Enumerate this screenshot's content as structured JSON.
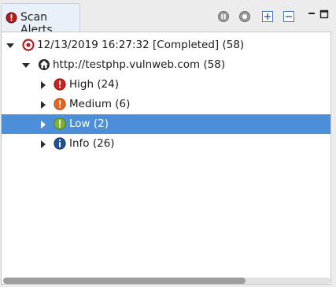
{
  "view": {
    "tab_title": "Scan Alerts",
    "tab_icon": "alert-icon",
    "toolbar": [
      {
        "name": "pause-button",
        "icon": "pause-icon"
      },
      {
        "name": "stop-button",
        "icon": "stop-icon"
      },
      {
        "name": "expand-all-button",
        "icon": "expand-all-icon"
      },
      {
        "name": "collapse-all-button",
        "icon": "collapse-all-icon"
      }
    ],
    "window_controls": [
      "minimize-icon",
      "maximize-icon"
    ]
  },
  "tree": {
    "scan": {
      "label": "12/13/2019 16:27:32 [Completed]  (58)",
      "icon": "scan-target-icon",
      "expanded": true
    },
    "site": {
      "label": "http://testphp.vulnweb.com (58)",
      "icon": "site-icon",
      "expanded": true
    },
    "severities": [
      {
        "label": "High (24)",
        "icon": "high-severity-icon",
        "color": "#cc1f1f",
        "selected": false
      },
      {
        "label": "Medium (6)",
        "icon": "medium-severity-icon",
        "color": "#e8661a",
        "selected": false
      },
      {
        "label": "Low (2)",
        "icon": "low-severity-icon",
        "color": "#7fb42a",
        "selected": true
      },
      {
        "label": "Info (26)",
        "icon": "info-icon",
        "color": "#1d4f9c",
        "selected": false
      }
    ]
  },
  "colors": {
    "selection": "#4c8fd8",
    "tab_background": "#eaf0f8"
  },
  "scrollbar": {
    "horizontal_position": 0,
    "visible_fraction": 0.74
  }
}
